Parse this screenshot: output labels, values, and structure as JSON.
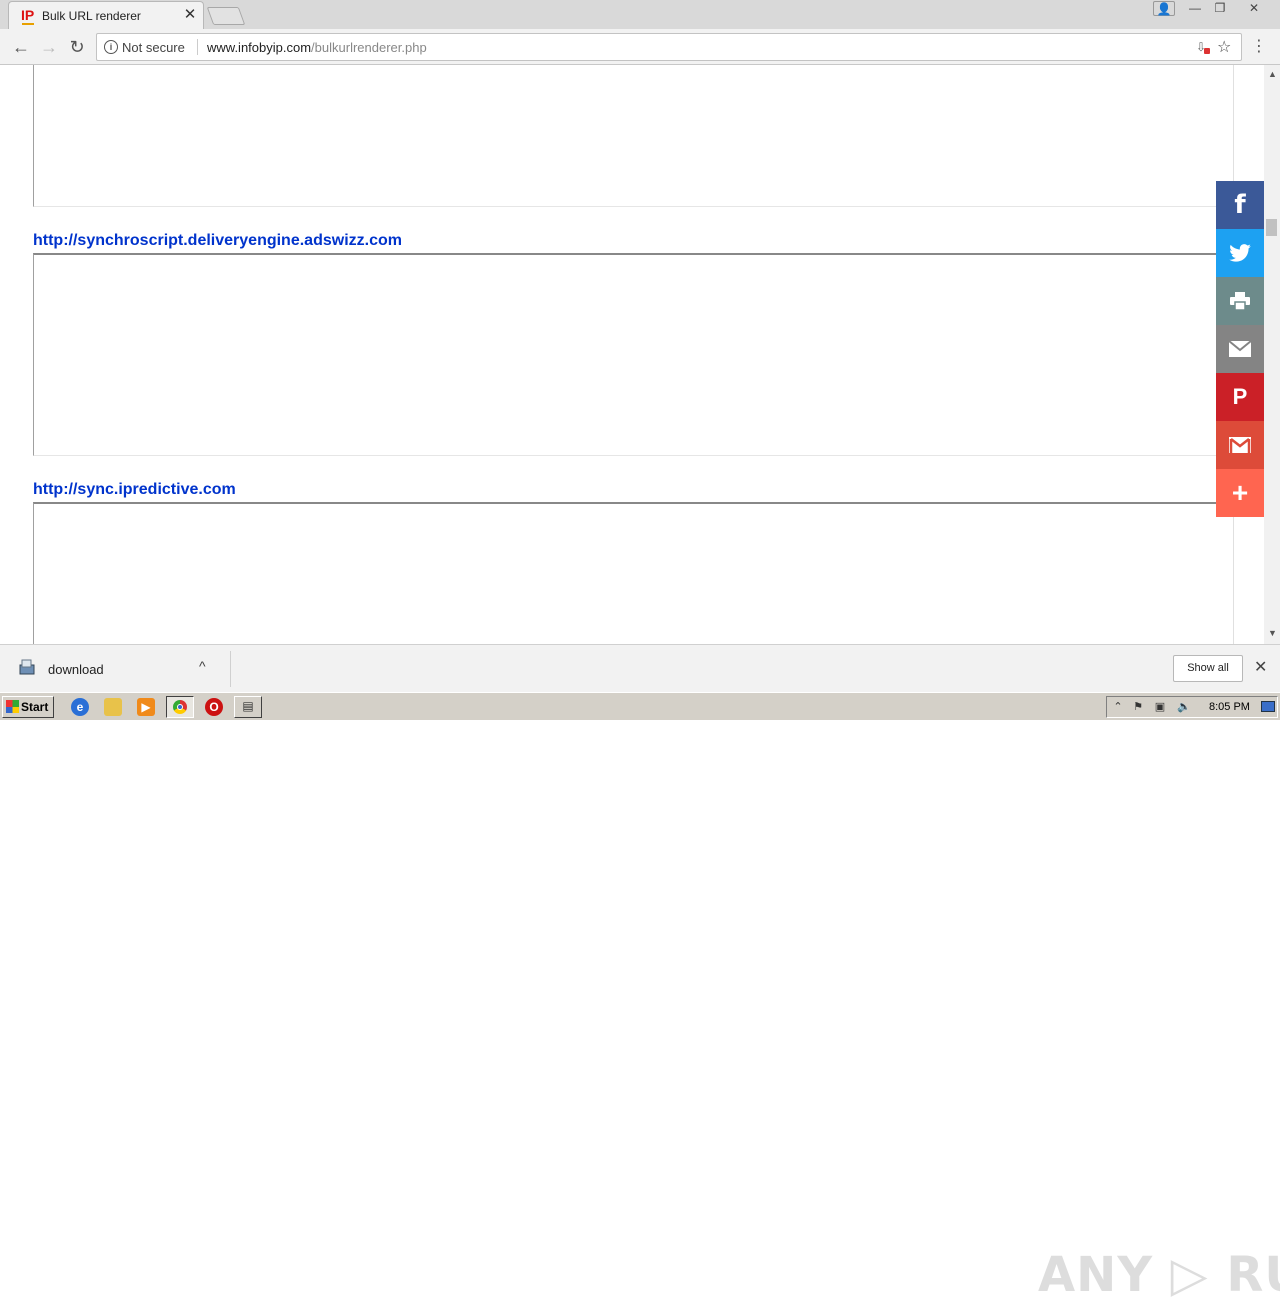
{
  "browser": {
    "tab": {
      "title": "Bulk URL renderer",
      "favicon_text": "IP",
      "close_glyph": "✕"
    },
    "window_controls": {
      "user": "👤",
      "minimize": "—",
      "restore": "❐",
      "close": "✕"
    },
    "nav": {
      "back": "←",
      "forward": "→",
      "reload": "↻"
    },
    "omnibox": {
      "security_label": "Not secure",
      "url_host": "www.infobyip.com",
      "url_path": "/bulkurlrenderer.php"
    },
    "icons": {
      "star": "☆",
      "menu": "⋮",
      "info": "i"
    }
  },
  "page": {
    "entries": [
      {
        "url": "http://synchroscript.deliveryengine.adswizz.com"
      },
      {
        "url": "http://sync.ipredictive.com"
      }
    ]
  },
  "share_bar": {
    "buttons": [
      {
        "name": "facebook",
        "glyph": "f",
        "color": "#3b5998"
      },
      {
        "name": "twitter",
        "glyph": "🐦",
        "color": "#1da1f2"
      },
      {
        "name": "print",
        "glyph": "⎙",
        "color": "#6d8b8b"
      },
      {
        "name": "email",
        "glyph": "✉",
        "color": "#848484"
      },
      {
        "name": "pinterest",
        "glyph": "P",
        "color": "#cb2027"
      },
      {
        "name": "gmail",
        "glyph": "M",
        "color": "#dd4b39"
      },
      {
        "name": "more",
        "glyph": "+",
        "color": "#ff6550"
      }
    ]
  },
  "download_shelf": {
    "file_name": "download",
    "chevron": "^",
    "show_all_label": "Show all",
    "close_glyph": "✕",
    "watermark": "ANY ▷ RUN"
  },
  "taskbar": {
    "start_label": "Start",
    "clock": "8:05 PM",
    "tray": {
      "arrow": "⌃",
      "flag": "⚑",
      "network": "▣",
      "volume": "🔈"
    },
    "opera_glyph": "O",
    "ie_glyph": "e"
  }
}
